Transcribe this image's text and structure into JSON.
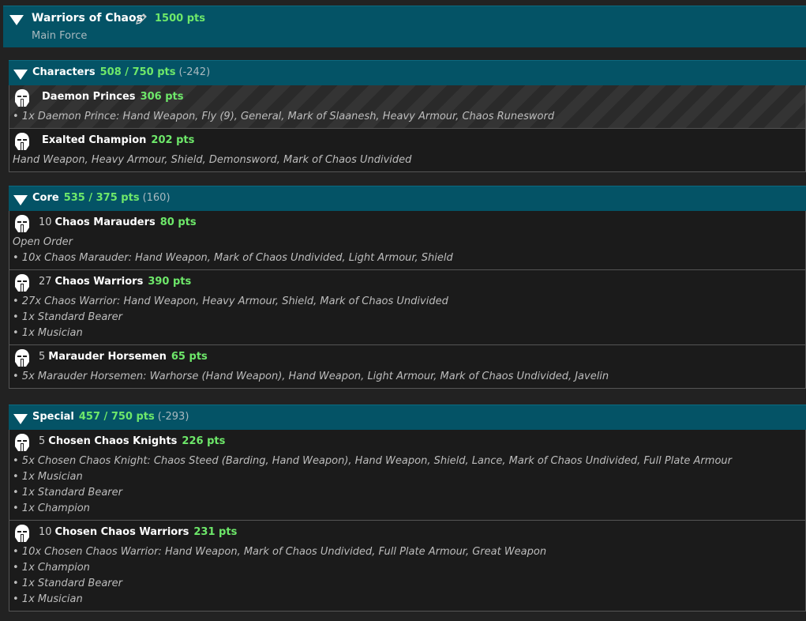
{
  "force": {
    "title": "Warriors of Chaos",
    "points": "1500 pts",
    "subtitle": "Main Force"
  },
  "categories": [
    {
      "name": "Characters",
      "points": "508 / 750 pts",
      "diff": "(-242)",
      "units": [
        {
          "count": "",
          "name": "Daemon Princes",
          "points": "306 pts",
          "lines": [
            "• 1x Daemon Prince: Hand Weapon, Fly (9), General, Mark of Slaanesh, Heavy Armour, Chaos Runesword"
          ]
        },
        {
          "count": "",
          "name": "Exalted Champion",
          "points": "202 pts",
          "lines": [
            "Hand Weapon, Heavy Armour, Shield, Demonsword, Mark of Chaos Undivided"
          ]
        }
      ]
    },
    {
      "name": "Core",
      "points": "535 / 375 pts",
      "diff": "(160)",
      "units": [
        {
          "count": "10",
          "name": "Chaos Marauders",
          "points": "80 pts",
          "lines": [
            "Open Order",
            "• 10x Chaos Marauder: Hand Weapon, Mark of Chaos Undivided, Light Armour, Shield"
          ]
        },
        {
          "count": "27",
          "name": "Chaos Warriors",
          "points": "390 pts",
          "lines": [
            "• 27x Chaos Warrior: Hand Weapon, Heavy Armour, Shield, Mark of Chaos Undivided",
            "• 1x Standard Bearer",
            "• 1x Musician"
          ]
        },
        {
          "count": "5",
          "name": "Marauder Horsemen",
          "points": "65 pts",
          "lines": [
            "• 5x Marauder Horsemen: Warhorse (Hand Weapon), Hand Weapon, Light Armour, Mark of Chaos Undivided, Javelin"
          ]
        }
      ]
    },
    {
      "name": "Special",
      "points": "457 / 750 pts",
      "diff": "(-293)",
      "units": [
        {
          "count": "5",
          "name": "Chosen Chaos Knights",
          "points": "226 pts",
          "lines": [
            "• 5x Chosen Chaos Knight: Chaos Steed (Barding, Hand Weapon), Hand Weapon, Shield, Lance, Mark of Chaos Undivided, Full Plate Armour",
            "• 1x Musician",
            "• 1x Standard Bearer",
            "• 1x Champion"
          ]
        },
        {
          "count": "10",
          "name": "Chosen Chaos Warriors",
          "points": "231 pts",
          "lines": [
            "• 10x Chosen Chaos Warrior: Hand Weapon, Mark of Chaos Undivided, Full Plate Armour, Great Weapon",
            "• 1x Champion",
            "• 1x Standard Bearer",
            "• 1x Musician"
          ]
        }
      ]
    }
  ],
  "colors": {
    "header_bg": "#045366",
    "points_green": "#6ee86a",
    "page_bg": "#222222"
  }
}
